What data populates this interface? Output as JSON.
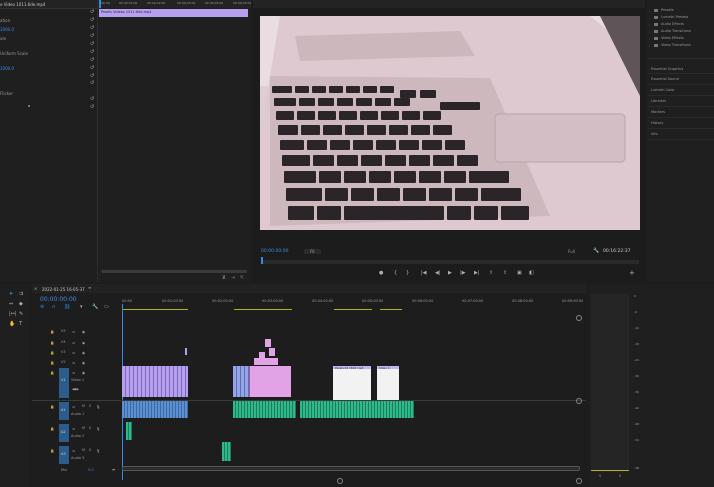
{
  "effect_controls": {
    "source_clip": "e Video 1011.6de.mp4",
    "rows": [
      {
        "label": "ation",
        "value": ""
      },
      {
        "label": "sition",
        "value": "1000.0"
      },
      {
        "label": "ale",
        "value": ""
      },
      {
        "label": "",
        "value": ""
      },
      {
        "label": "",
        "value": "Uniform Scale"
      },
      {
        "label": "tation",
        "value": ""
      },
      {
        "label": "chor Point",
        "value": "1000.0"
      },
      {
        "label": "",
        "value": ""
      },
      {
        "label": "Flicker",
        "value": ""
      },
      {
        "label": "",
        "value": ""
      },
      {
        "label": "",
        "value": ""
      },
      {
        "label": "",
        "value": ""
      }
    ],
    "mini_clip_name": "Pexels Videos 1011.6de.mp4",
    "ruler_ticks": [
      "00:00",
      "00:00:01:00",
      "00:00:02:00",
      "00:00:03:00",
      "00:00:04:00",
      "00:00:05:00"
    ]
  },
  "program_monitor": {
    "timecode": "00:00:00:00",
    "fit": "Fit",
    "quality": "Full",
    "duration": "00:16:22:37"
  },
  "effects_panel": {
    "tree_items": [
      "Presets",
      "Lumetri Presets",
      "Audio Effects",
      "Audio Transitions",
      "Video Effects",
      "Video Transitions"
    ],
    "panels": [
      "Essential Graphics",
      "Essential Sound",
      "Lumetri Color",
      "Libraries",
      "Markers",
      "History",
      "Info"
    ]
  },
  "timeline": {
    "sequence_name": "2022-01-25 16-05-37",
    "timecode": "00:00:00:00",
    "ruler": [
      "00:00",
      "00:01:00:00",
      "00:02:00:00",
      "00:03:00:00",
      "00:04:00:00",
      "00:05:00:00",
      "00:06:00:00",
      "00:07:00:00",
      "00:08:00:00",
      "00:09:00:00"
    ],
    "video_tracks": [
      "V5",
      "V4",
      "V3",
      "V2",
      "V1"
    ],
    "v1_name": "Video 1",
    "audio_tracks": [
      "A1",
      "A2",
      "A3"
    ],
    "a1_name": "Audio 1",
    "a2_name": "Audio 2",
    "a3_name": "Audio 3",
    "mix_label": "Mix",
    "mix_value": "0.0",
    "title_clip_1": "Pexels 42 1616 mp4",
    "title_clip_2": "Video 1"
  },
  "audio_meter": {
    "scale": [
      "0",
      "-6",
      "-12",
      "-18",
      "-24",
      "-30",
      "-36",
      "-42",
      "-48",
      "-54",
      "-dB"
    ],
    "channels": [
      "S",
      "S"
    ]
  },
  "colors": {
    "accent_blue": "#2d8ceb",
    "clip_purple": "#b79ff0",
    "clip_pink": "#e2a3e6",
    "audio_green": "#2fb98b",
    "audio_blue": "#5b8fd0",
    "workarea_yellow": "#b8b11a"
  }
}
